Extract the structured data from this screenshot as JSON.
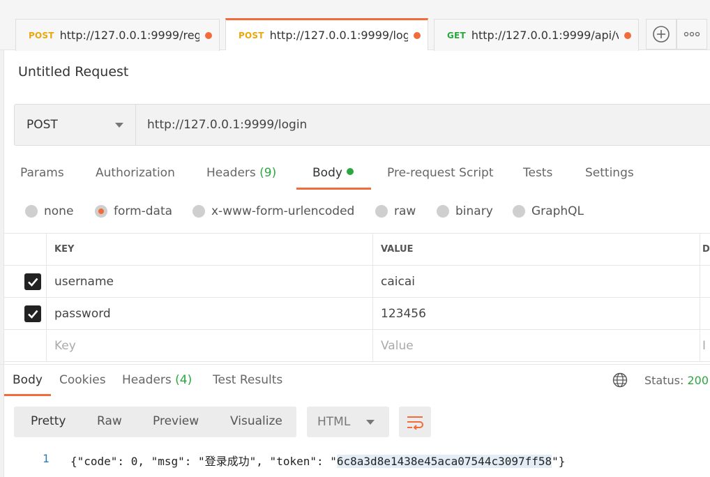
{
  "tabs": [
    {
      "method": "POST",
      "url": "http://127.0.0.1:9999/regi…"
    },
    {
      "method": "POST",
      "url": "http://127.0.0.1:9999/login"
    },
    {
      "method": "GET",
      "url": "http://127.0.0.1:9999/api/v…"
    }
  ],
  "tab_actions": {
    "add_icon": "plus-circle-icon",
    "more_icon": "more-horizontal-icon"
  },
  "request": {
    "title": "Untitled Request",
    "method": "POST",
    "url": "http://127.0.0.1:9999/login"
  },
  "request_tabs": {
    "params": "Params",
    "authorization": "Authorization",
    "headers": "Headers",
    "headers_count": "(9)",
    "body": "Body",
    "pre_request": "Pre-request Script",
    "tests": "Tests",
    "settings": "Settings"
  },
  "body_types": {
    "none": "none",
    "form_data": "form-data",
    "urlencoded": "x-www-form-urlencoded",
    "raw": "raw",
    "binary": "binary",
    "graphql": "GraphQL"
  },
  "params_table": {
    "key_header": "KEY",
    "value_header": "VALUE",
    "desc_header": "D",
    "rows": [
      {
        "key": "username",
        "value": "caicai"
      },
      {
        "key": "password",
        "value": "123456"
      }
    ],
    "key_placeholder": "Key",
    "value_placeholder": "Value",
    "desc_placeholder": "I"
  },
  "response_tabs": {
    "body": "Body",
    "cookies": "Cookies",
    "headers": "Headers",
    "headers_count": "(4)",
    "test_results": "Test Results"
  },
  "status": {
    "label": "Status:",
    "code": "200 ("
  },
  "view_modes": {
    "pretty": "Pretty",
    "raw": "Raw",
    "preview": "Preview",
    "visualize": "Visualize"
  },
  "format": "HTML",
  "response_body": {
    "line_number": "1",
    "prefix": "{\"code\": 0, \"msg\": \"登录成功\", \"token\": \"",
    "token": "6c8a3d8e1438e45aca07544c3097ff58",
    "suffix": "\"}"
  },
  "colors": {
    "accent": "#f26b3a",
    "success": "#2aa83f",
    "post": "#e8a80c",
    "get": "#2aa83f"
  }
}
